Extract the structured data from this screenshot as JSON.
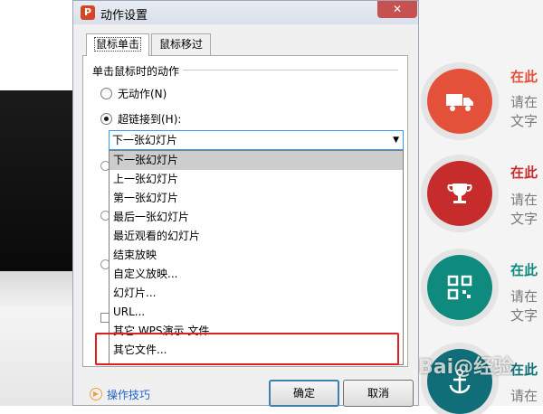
{
  "dialog": {
    "title": "动作设置",
    "app_icon_letter": "P",
    "close_symbol": "✕",
    "tabs": [
      {
        "label": "鼠标单击"
      },
      {
        "label": "鼠标移过"
      }
    ],
    "group_label": "单击鼠标时的动作",
    "options": {
      "none": "无动作(N)",
      "hyperlink": "超链接到(H):"
    },
    "select": {
      "value": "下一张幻灯片",
      "items": [
        "下一张幻灯片",
        "上一张幻灯片",
        "第一张幻灯片",
        "最后一张幻灯片",
        "最近观看的幻灯片",
        "结束放映",
        "自定义放映...",
        "幻灯片...",
        "URL...",
        "其它 WPS演示 文件",
        "其它文件..."
      ]
    },
    "help_text": "操作技巧",
    "ok_label": "确定",
    "cancel_label": "取消"
  },
  "background": {
    "items": [
      {
        "title": "在此",
        "text1": "请在",
        "text2": "文字",
        "color": "#e3513a",
        "icon": "truck-icon"
      },
      {
        "title": "在此",
        "text1": "请在",
        "text2": "文字",
        "color": "#c62c2c",
        "icon": "trophy-icon"
      },
      {
        "title": "在此",
        "text1": "请在",
        "text2": "文字",
        "color": "#0f8a7e",
        "icon": "qr-code-icon"
      },
      {
        "title": "在此",
        "text1": "请在",
        "color": "#0f6e78",
        "icon": "anchor-icon"
      }
    ],
    "watermark": "Bai@经验"
  }
}
